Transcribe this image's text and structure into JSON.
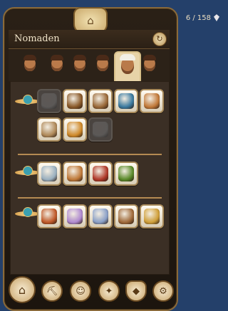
{
  "header": {
    "counter": "6 / 158",
    "title": "Nomaden"
  },
  "tabs": [
    {
      "name": "portrait-1",
      "active": false
    },
    {
      "name": "portrait-2",
      "active": false
    },
    {
      "name": "portrait-3",
      "active": false
    },
    {
      "name": "portrait-4",
      "active": false
    },
    {
      "name": "portrait-5",
      "active": true
    },
    {
      "name": "portrait-6",
      "active": false
    }
  ],
  "groups": [
    {
      "items": [
        {
          "icon": "shovel-icon",
          "locked": true,
          "color": "#6a6a6a"
        },
        {
          "icon": "scales-icon",
          "locked": false,
          "color": "#8a5a2a"
        },
        {
          "icon": "market-stall-icon",
          "locked": false,
          "color": "#9a6a3a"
        },
        {
          "icon": "compass-icon",
          "locked": false,
          "color": "#3a7aa0"
        },
        {
          "icon": "bread-icon",
          "locked": false,
          "color": "#c27a3a"
        },
        {
          "icon": "milk-bowl-icon",
          "locked": false,
          "color": "#b08a5a"
        },
        {
          "icon": "spice-piles-icon",
          "locked": false,
          "color": "#d08a2a"
        },
        {
          "icon": "tent-icon",
          "locked": true,
          "color": "#6a6a6a"
        }
      ]
    },
    {
      "items": [
        {
          "icon": "ivory-tusks-icon",
          "locked": false,
          "color": "#9ab0c0"
        },
        {
          "icon": "gold-coins-icon",
          "locked": false,
          "color": "#c07a3a"
        },
        {
          "icon": "fabric-rolls-icon",
          "locked": false,
          "color": "#b03a2a"
        },
        {
          "icon": "palm-tree-icon",
          "locked": false,
          "color": "#5a8a2a"
        }
      ]
    },
    {
      "items": [
        {
          "icon": "copper-ore-icon",
          "locked": false,
          "color": "#c05a2a"
        },
        {
          "icon": "crystal-icon",
          "locked": false,
          "color": "#b08ad0"
        },
        {
          "icon": "silk-bundles-icon",
          "locked": false,
          "color": "#8aa0c8"
        },
        {
          "icon": "caravanserai-icon",
          "locked": false,
          "color": "#a06a3a"
        },
        {
          "icon": "crescent-icon",
          "locked": false,
          "color": "#d0a03a"
        }
      ]
    }
  ],
  "nav": [
    {
      "icon": "home-icon",
      "glyph": "⌂"
    },
    {
      "icon": "pickaxe-icon",
      "glyph": "⛏"
    },
    {
      "icon": "people-icon",
      "glyph": "☺"
    },
    {
      "icon": "compass-rose-icon",
      "glyph": "✦"
    },
    {
      "icon": "shield-icon",
      "glyph": "◆"
    },
    {
      "icon": "settings-icon",
      "glyph": "⚙"
    }
  ]
}
